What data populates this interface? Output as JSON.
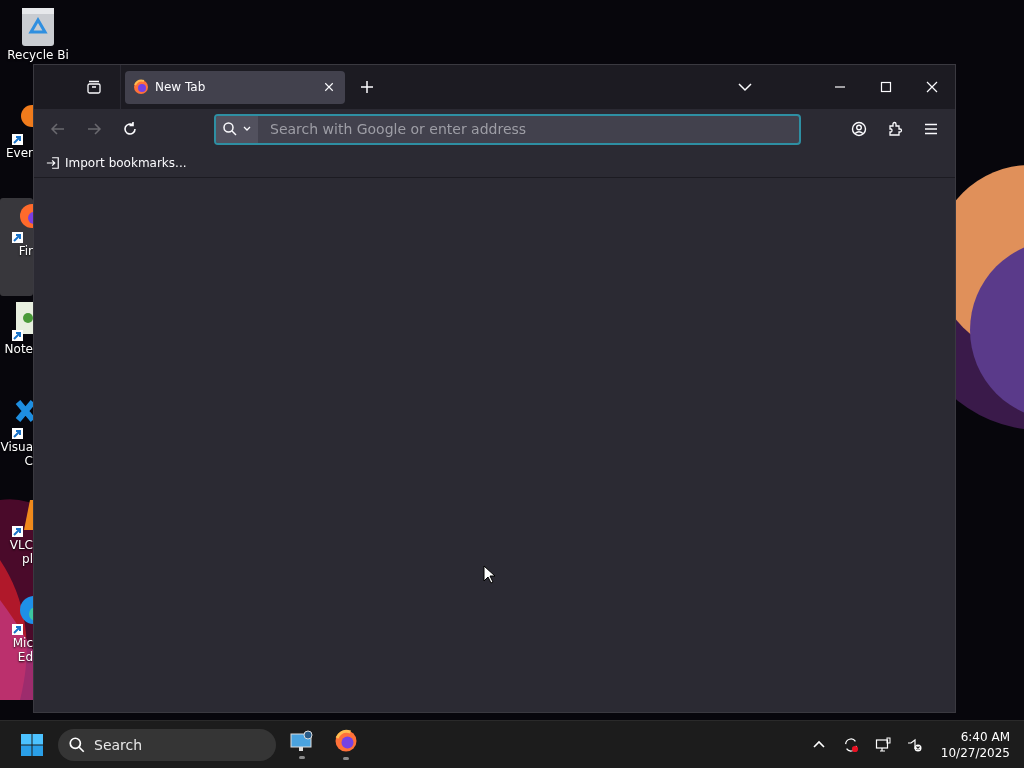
{
  "desktop": {
    "icons": [
      {
        "kind": "recycle",
        "label": [
          "Recycle Bi"
        ],
        "selected": false
      },
      {
        "kind": "orange",
        "label": [
          "Ever"
        ],
        "selected": false
      },
      {
        "kind": "fox",
        "label": [
          "Fir"
        ],
        "selected": true
      },
      {
        "kind": "notepad",
        "label": [
          "Note"
        ],
        "selected": false
      },
      {
        "kind": "blue-x",
        "label": [
          "Visua",
          "C"
        ],
        "selected": false
      },
      {
        "kind": "cone",
        "label": [
          "VLC",
          "pl"
        ],
        "selected": false
      },
      {
        "kind": "wave",
        "label": [
          "Mic",
          "Ed"
        ],
        "selected": false
      }
    ]
  },
  "window": {
    "tabs": [
      {
        "title": "New Tab",
        "selected": true
      }
    ],
    "nav": [
      {
        "kind": "back",
        "disabled": true
      },
      {
        "kind": "forward",
        "disabled": true
      },
      {
        "kind": "reload",
        "disabled": false
      }
    ],
    "address": {
      "placeholder": "Search with Google or enter address"
    },
    "bookmarks": [
      "Import bookmarks..."
    ]
  },
  "taskbar": {
    "search": {
      "placeholder": "Search"
    },
    "apps": [
      {
        "kind": "remote",
        "running": true
      },
      {
        "kind": "fox",
        "running": true
      }
    ],
    "clock": {
      "time": "6:40 AM",
      "date": "10/27/2025"
    }
  }
}
